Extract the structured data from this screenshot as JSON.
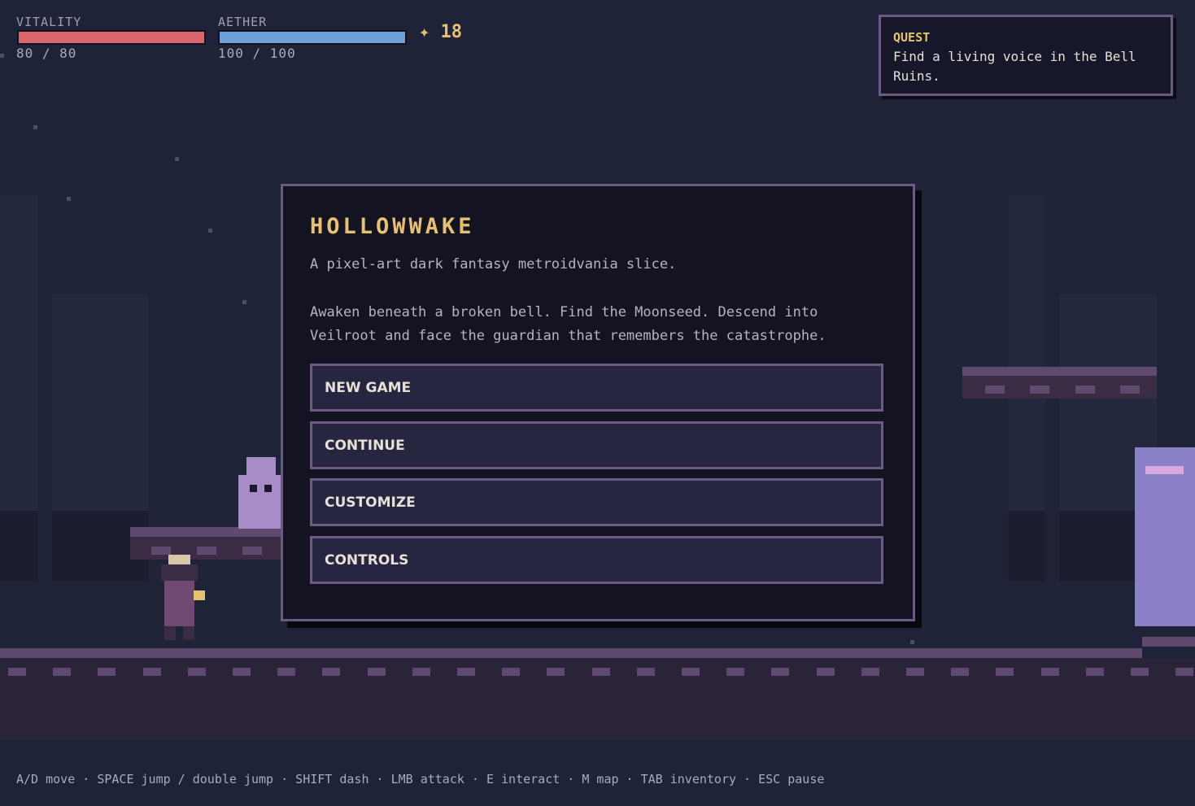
{
  "hud": {
    "vitality": {
      "label": "VITALITY",
      "current": 80,
      "max": 80,
      "text": "80 / 80",
      "color": "#d9666a"
    },
    "aether": {
      "label": "AETHER",
      "current": 100,
      "max": 100,
      "text": "100 / 100",
      "color": "#6fa0d8"
    },
    "coins": {
      "icon": "sparkle-icon",
      "glyph": "✦",
      "count": "18"
    }
  },
  "quest": {
    "title": "QUEST",
    "text": "Find a living voice in the Bell Ruins."
  },
  "menu": {
    "title": "HOLLOWWAKE",
    "subtitle": "A pixel-art dark fantasy metroidvania slice.",
    "description": "Awaken beneath a broken bell. Find the Moonseed. Descend into Veilroot and face the guardian that remembers the catastrophe.",
    "buttons": [
      {
        "label": "NEW GAME"
      },
      {
        "label": "CONTINUE"
      },
      {
        "label": "CUSTOMIZE"
      },
      {
        "label": "CONTROLS"
      }
    ]
  },
  "controls_hint": "A/D move · SPACE jump / double jump · SHIFT dash · LMB attack · E interact · M map · TAB inventory · ESC pause",
  "colors": {
    "background": "#1f2338",
    "accent_gold": "#e8c170",
    "frame_purple": "#6b5a86",
    "ghost": "#a88cc8",
    "door": "#8a80c8"
  }
}
